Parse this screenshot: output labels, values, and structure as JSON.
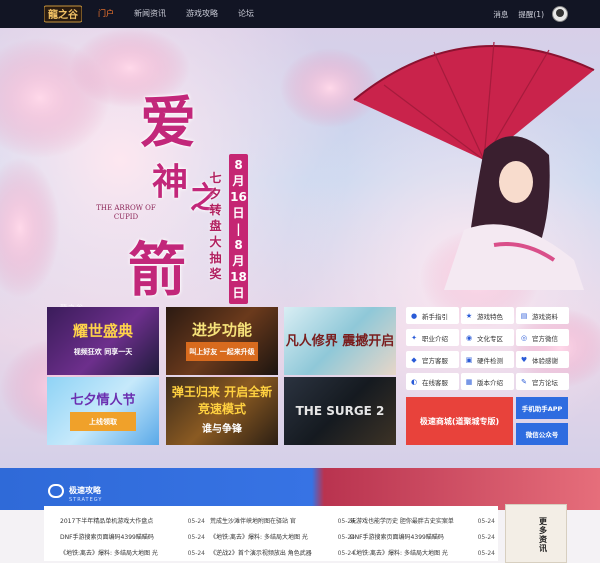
{
  "topbar": {
    "logo_text": "龍之谷",
    "nav": [
      "门户",
      "新闻资讯",
      "游戏攻略",
      "论坛"
    ],
    "active_index": 0,
    "messages": "消息",
    "reminder": "提醒(1)"
  },
  "hero": {
    "title_chars": [
      "爱",
      "神",
      "之",
      "箭"
    ],
    "subtitle_en": "THE ARROW OF CUPID",
    "date_panel_1": [
      "8",
      "月",
      "16",
      "日",
      "|",
      "8",
      "月",
      "18",
      "日"
    ],
    "date_panel_2": [
      "七",
      "夕",
      "转",
      "盘",
      "大",
      "抽",
      "奖"
    ],
    "logo_caption": "龍之谷"
  },
  "tiles": [
    {
      "title": "耀世盛典",
      "sub": "视频狂欢 同享一天"
    },
    {
      "title": "进步功能",
      "sub": "叫上好友 一起来升级"
    },
    {
      "title": "凡人修界 震撼开启",
      "sub": ""
    },
    {
      "title": "七夕情人节",
      "sub": "上线领取"
    },
    {
      "title": "弹王归来 开启全新竞速模式",
      "sub": "谁与争锋"
    },
    {
      "title": "THE SURGE 2",
      "sub": ""
    }
  ],
  "side_links": [
    {
      "label": "新手指引",
      "icon": "user-icon"
    },
    {
      "label": "游戏特色",
      "icon": "star-icon"
    },
    {
      "label": "游戏资料",
      "icon": "book-icon"
    },
    {
      "label": "职业介绍",
      "icon": "sword-icon"
    },
    {
      "label": "文化专区",
      "icon": "chat-icon"
    },
    {
      "label": "官方微信",
      "icon": "wechat-icon"
    },
    {
      "label": "官方客服",
      "icon": "service-icon"
    },
    {
      "label": "硬件检测",
      "icon": "monitor-icon"
    },
    {
      "label": "体验感谢",
      "icon": "heart-icon"
    },
    {
      "label": "在线客服",
      "icon": "headset-icon"
    },
    {
      "label": "版本介绍",
      "icon": "doc-icon"
    },
    {
      "label": "官方论坛",
      "icon": "forum-icon"
    }
  ],
  "store_button": "极速商城(道聚城专版)",
  "app_button": "手机助手APP",
  "wechat_button": "微信公众号",
  "strategy": {
    "title": "极速攻略",
    "subtitle": "STRATEGY"
  },
  "news_cols": [
    [
      {
        "title": "2017下半年精品单机游戏大作盘点",
        "date": "05-24"
      },
      {
        "title": "DNF手游搜索页面编码4399瞄瞄码",
        "date": "05-24"
      },
      {
        "title": "《地铁:离去》爆料: 多结局大地图 光",
        "date": "05-24"
      }
    ],
    [
      {
        "title": "荒成生沙滩伴峡地附图在驿站 官",
        "date": "05-24"
      },
      {
        "title": "《地铁:离去》爆料: 多结局大地图 光",
        "date": "05-24"
      },
      {
        "title": "《逆战2》首个演示视频放出 角色武器",
        "date": "05-24"
      }
    ],
    [
      {
        "title": "玩游戏也能学历史 胆你最胖古史实案单",
        "date": "05-24"
      },
      {
        "title": "DNF手游搜索页面编码4399瞄瞄码",
        "date": "05-24"
      },
      {
        "title": "《地铁:离去》爆料: 多结局大地图 光",
        "date": "05-24"
      }
    ]
  ],
  "book_text": "更多资讯"
}
